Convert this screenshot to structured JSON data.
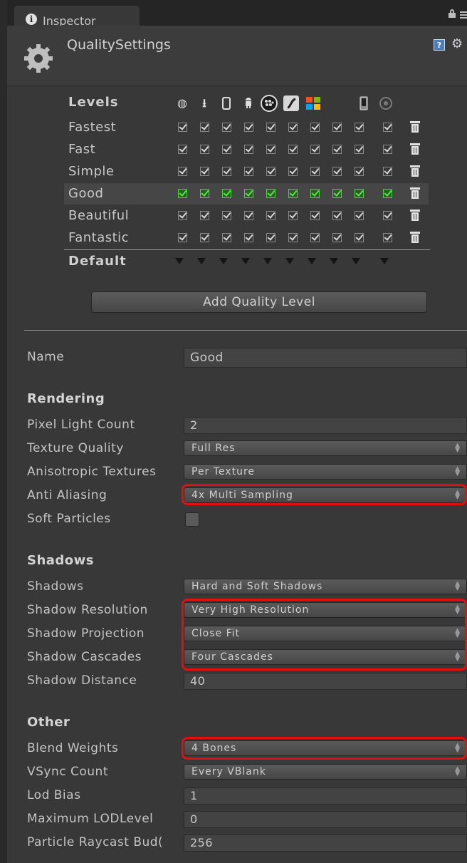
{
  "tab": {
    "label": "Inspector",
    "icon": "info-icon"
  },
  "header": {
    "title": "QualitySettings"
  },
  "levels": {
    "header": "Levels",
    "platform_icons": [
      "globe-icon",
      "download-icon",
      "phone-icon",
      "android-icon",
      "blackberry-icon",
      "flash-icon",
      "windows-icon",
      "windows-phone-icon",
      "console-icon"
    ],
    "rows": [
      {
        "name": "Fastest",
        "selected": false
      },
      {
        "name": "Fast",
        "selected": false
      },
      {
        "name": "Simple",
        "selected": false
      },
      {
        "name": "Good",
        "selected": true
      },
      {
        "name": "Beautiful",
        "selected": false
      },
      {
        "name": "Fantastic",
        "selected": false
      }
    ],
    "default_label": "Default",
    "add_button": "Add Quality Level"
  },
  "name": {
    "label": "Name",
    "value": "Good"
  },
  "rendering": {
    "title": "Rendering",
    "pixel_light_count": {
      "label": "Pixel Light Count",
      "value": "2"
    },
    "texture_quality": {
      "label": "Texture Quality",
      "value": "Full Res"
    },
    "anisotropic_textures": {
      "label": "Anisotropic Textures",
      "value": "Per Texture"
    },
    "anti_aliasing": {
      "label": "Anti Aliasing",
      "value": "4x Multi Sampling"
    },
    "soft_particles": {
      "label": "Soft Particles",
      "checked": false
    }
  },
  "shadows": {
    "title": "Shadows",
    "shadows": {
      "label": "Shadows",
      "value": "Hard and Soft Shadows"
    },
    "shadow_resolution": {
      "label": "Shadow Resolution",
      "value": "Very High Resolution"
    },
    "shadow_projection": {
      "label": "Shadow Projection",
      "value": "Close Fit"
    },
    "shadow_cascades": {
      "label": "Shadow Cascades",
      "value": "Four Cascades"
    },
    "shadow_distance": {
      "label": "Shadow Distance",
      "value": "40"
    }
  },
  "other": {
    "title": "Other",
    "blend_weights": {
      "label": "Blend Weights",
      "value": "4 Bones"
    },
    "vsync_count": {
      "label": "VSync Count",
      "value": "Every VBlank"
    },
    "lod_bias": {
      "label": "Lod Bias",
      "value": "1"
    },
    "maximum_lod_level": {
      "label": "Maximum LODLevel",
      "value": "0"
    },
    "particle_raycast_budget": {
      "label": "Particle Raycast Bud(",
      "value": "256"
    }
  },
  "colors": {
    "highlight": "#e01010",
    "selected_check": "#55e44a",
    "background": "#383838"
  }
}
